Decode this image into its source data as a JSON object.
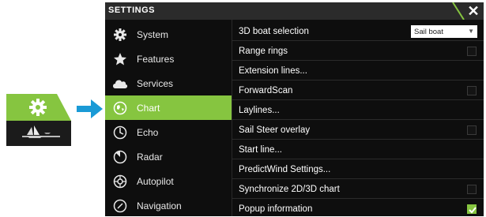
{
  "window": {
    "title": "SETTINGS",
    "close_glyph": "✕"
  },
  "sidebar": {
    "items": [
      {
        "label": "System",
        "icon": "gear-icon",
        "active": false
      },
      {
        "label": "Features",
        "icon": "star-icon",
        "active": false
      },
      {
        "label": "Services",
        "icon": "cloud-icon",
        "active": false
      },
      {
        "label": "Chart",
        "icon": "chart-globe-icon",
        "active": true
      },
      {
        "label": "Echo",
        "icon": "echo-icon",
        "active": false
      },
      {
        "label": "Radar",
        "icon": "radar-icon",
        "active": false
      },
      {
        "label": "Autopilot",
        "icon": "autopilot-icon",
        "active": false
      },
      {
        "label": "Navigation",
        "icon": "navigation-icon",
        "active": false
      }
    ]
  },
  "options": {
    "boat_selection": {
      "label": "3D boat selection",
      "value": "Sail boat"
    },
    "range_rings": {
      "label": "Range rings",
      "checked": false
    },
    "extension_lines": {
      "label": "Extension lines..."
    },
    "forward_scan": {
      "label": "ForwardScan",
      "checked": false
    },
    "laylines": {
      "label": "Laylines..."
    },
    "sail_steer": {
      "label": "Sail Steer overlay",
      "checked": false
    },
    "start_line": {
      "label": "Start line..."
    },
    "predictwind": {
      "label": "PredictWind Settings..."
    },
    "sync_2d3d": {
      "label": "Synchronize 2D/3D chart",
      "checked": false
    },
    "popup_info": {
      "label": "Popup information",
      "checked": true
    }
  },
  "colors": {
    "accent": "#86c540",
    "background": "#0e0e0e",
    "arrow": "#1a9ad6"
  }
}
